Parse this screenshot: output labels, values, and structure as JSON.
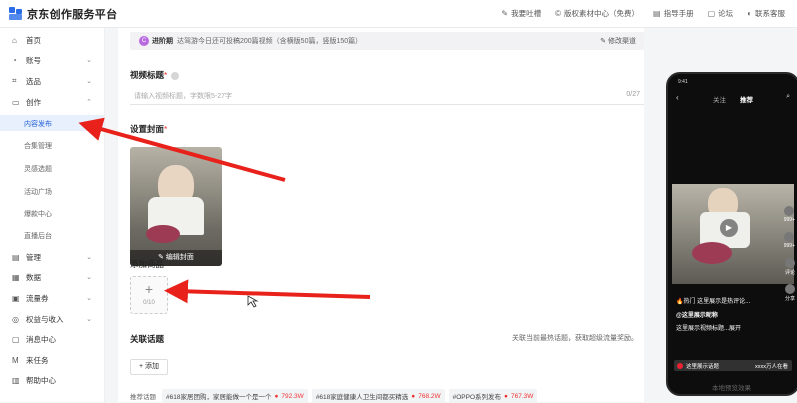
{
  "app": {
    "title": "京东创作服务平台"
  },
  "toplinks": [
    {
      "label": "我要吐槽",
      "icon": "edit-icon"
    },
    {
      "label": "版权素材中心（免费）",
      "icon": "copyright-icon"
    },
    {
      "label": "指导手册",
      "icon": "book-icon"
    },
    {
      "label": "论坛",
      "icon": "forum-icon"
    },
    {
      "label": "联系客服",
      "icon": "headset-icon"
    }
  ],
  "sidebar": {
    "items": [
      {
        "label": "首页",
        "icon": "home-icon"
      },
      {
        "label": "账号",
        "icon": "user-icon"
      },
      {
        "label": "选品",
        "icon": "scan-icon"
      },
      {
        "label": "创作",
        "icon": "folder-icon"
      },
      {
        "label": "管理",
        "icon": "doc-icon"
      },
      {
        "label": "数据",
        "icon": "data-icon"
      },
      {
        "label": "流量券",
        "icon": "coupon-icon"
      },
      {
        "label": "权益与收入",
        "icon": "money-icon"
      },
      {
        "label": "消息中心",
        "icon": "message-icon"
      },
      {
        "label": "来任务",
        "icon": "mail-icon"
      },
      {
        "label": "帮助中心",
        "icon": "help-icon"
      }
    ],
    "create_sub": [
      "内容发布",
      "合集管理",
      "灵感选题",
      "活动广场",
      "爆款中心",
      "直播后台"
    ]
  },
  "notice": {
    "badge": "C",
    "tag": "进阶期",
    "message": "达驾游今日还可投稿200篇视频（含横版50篇，竖版150篇）",
    "edit_label": "修改渠道"
  },
  "video_title": {
    "label": "视频标题",
    "required": "*",
    "placeholder": "请输入视频标题，字数限5-27字",
    "counter": "0/27"
  },
  "cover": {
    "label": "设置封面",
    "required": "*",
    "edit_label": "编辑封面"
  },
  "product": {
    "label": "添加商品",
    "plus": "+",
    "count": "0/10"
  },
  "topic": {
    "label": "关联话题",
    "note": "关联当前最热话题，获取超级流量奖励。",
    "add_label": "+ 添加",
    "rec_label": "推荐话题",
    "chips": [
      {
        "text": "#618家居团购，家居能做一个是一个",
        "hot": "792.3W"
      },
      {
        "text": "#618家庭健康人卫生间都买精选",
        "hot": "768.2W"
      },
      {
        "text": "#OPPO系列发布",
        "hot": "767.3W"
      }
    ]
  },
  "preview": {
    "time": "9:41",
    "tab_follow": "关注",
    "tab_recommend": "推荐",
    "side_counts": [
      "999+",
      "999+",
      "评论",
      "分享"
    ],
    "hot_tag": "🔥热门",
    "hot_text": "这里展示是热评论...",
    "author": "@这里展示昵称",
    "desc": "这里展示视频标题...展开",
    "bar_left": "这里展示话题",
    "bar_right": "xxxx万人在看",
    "caption": "本地预览效果"
  }
}
